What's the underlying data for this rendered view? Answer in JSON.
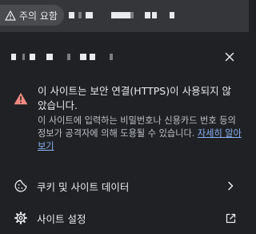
{
  "toolbar": {
    "security_chip": {
      "label": "주의 요함",
      "icon": "warning-triangle-icon"
    }
  },
  "popup": {
    "close_icon": "close-icon",
    "warning": {
      "icon": "warning-triangle-icon",
      "icon_color": "#f28b82",
      "title": "이 사이트는 보안 연결(HTTPS)이 사용되지 않았습니다.",
      "description": "이 사이트에 입력하는 비밀번호나 신용카드 번호 등의 정보가 공격자에 의해 도용될 수 있습니다.",
      "learn_more": "자세히 알아보기",
      "link_color": "#8ab4f8"
    },
    "menu": {
      "cookies": {
        "label": "쿠키 및 사이트 데이터",
        "icon": "cookie-icon",
        "trailing_icon": "chevron-right-icon"
      },
      "site_settings": {
        "label": "사이트 설정",
        "icon": "gear-icon",
        "trailing_icon": "external-link-icon"
      }
    }
  }
}
